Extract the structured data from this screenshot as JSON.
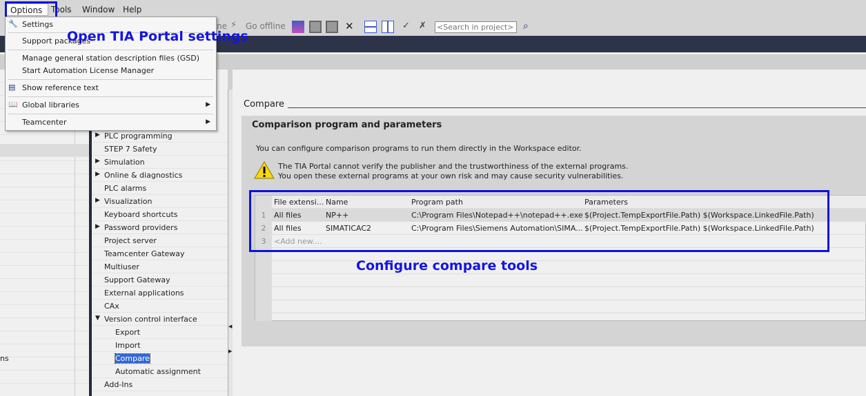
{
  "menubar": {
    "items": [
      "Options",
      "Tools",
      "Window",
      "Help"
    ]
  },
  "toolbar": {
    "go_online_partial": "ne",
    "go_offline": "Go offline",
    "search_placeholder": "<Search in project>"
  },
  "options_menu": {
    "items": [
      {
        "label": "Settings",
        "icon": "wrench-icon"
      },
      {
        "label": "Support packages"
      },
      {
        "label": "Manage general station description files (GSD)"
      },
      {
        "label": "Start Automation License Manager"
      },
      {
        "label": "Show reference text",
        "icon": "reference-text-icon"
      },
      {
        "label": "Global libraries",
        "icon": "book-icon",
        "submenu": true
      },
      {
        "label": "Teamcenter",
        "submenu": true
      }
    ]
  },
  "left_pane": {
    "partial_text": "ns"
  },
  "tree": {
    "items": [
      {
        "label": "PLC programming",
        "expandable": true
      },
      {
        "label": "STEP 7 Safety"
      },
      {
        "label": "Simulation",
        "expandable": true
      },
      {
        "label": "Online & diagnostics",
        "expandable": true
      },
      {
        "label": "PLC alarms"
      },
      {
        "label": "Visualization",
        "expandable": true
      },
      {
        "label": "Keyboard shortcuts"
      },
      {
        "label": "Password providers",
        "expandable": true
      },
      {
        "label": "Project server"
      },
      {
        "label": "Teamcenter Gateway"
      },
      {
        "label": "Multiuser"
      },
      {
        "label": "Support Gateway"
      },
      {
        "label": "External applications"
      },
      {
        "label": "CAx"
      },
      {
        "label": "Version control interface",
        "expanded": true
      },
      {
        "label": "Export",
        "child": true
      },
      {
        "label": "Import",
        "child": true
      },
      {
        "label": "Compare",
        "child": true,
        "selected": true
      },
      {
        "label": "Automatic assignment",
        "child": true
      },
      {
        "label": "Add-Ins"
      }
    ]
  },
  "content": {
    "header": "Compare",
    "section_title": "Comparison program and parameters",
    "info": "You can configure comparison programs to run them directly in the Workspace editor.",
    "warning_line1": "The TIA Portal cannot verify the publisher and the trustworthiness of the external programs.",
    "warning_line2": "You open these external programs at your own risk and may cause security vulnerabilities.",
    "table": {
      "columns": [
        "File extensi...",
        "Name",
        "Program path",
        "Parameters"
      ],
      "rows": [
        {
          "n": "1",
          "ext": "All files",
          "name": "NP++",
          "path": "C:\\Program Files\\Notepad++\\notepad++.exe",
          "params": "$(Project.TempExportFile.Path) $(Workspace.LinkedFile.Path)"
        },
        {
          "n": "2",
          "ext": "All files",
          "name": "SIMATICAC2",
          "path": "C:\\Program Files\\Siemens Automation\\SIMA...",
          "params": "$(Project.TempExportFile.Path) $(Workspace.LinkedFile.Path)"
        },
        {
          "n": "3",
          "ext": "<Add new....",
          "name": "",
          "path": "",
          "params": ""
        }
      ]
    }
  },
  "annotations": {
    "settings": "Open TIA Portal settings",
    "compare": "Configure compare tools"
  },
  "colors": {
    "annotation": "#0a12e0",
    "selection": "#3267d6",
    "title_bar": "#2d3349"
  }
}
